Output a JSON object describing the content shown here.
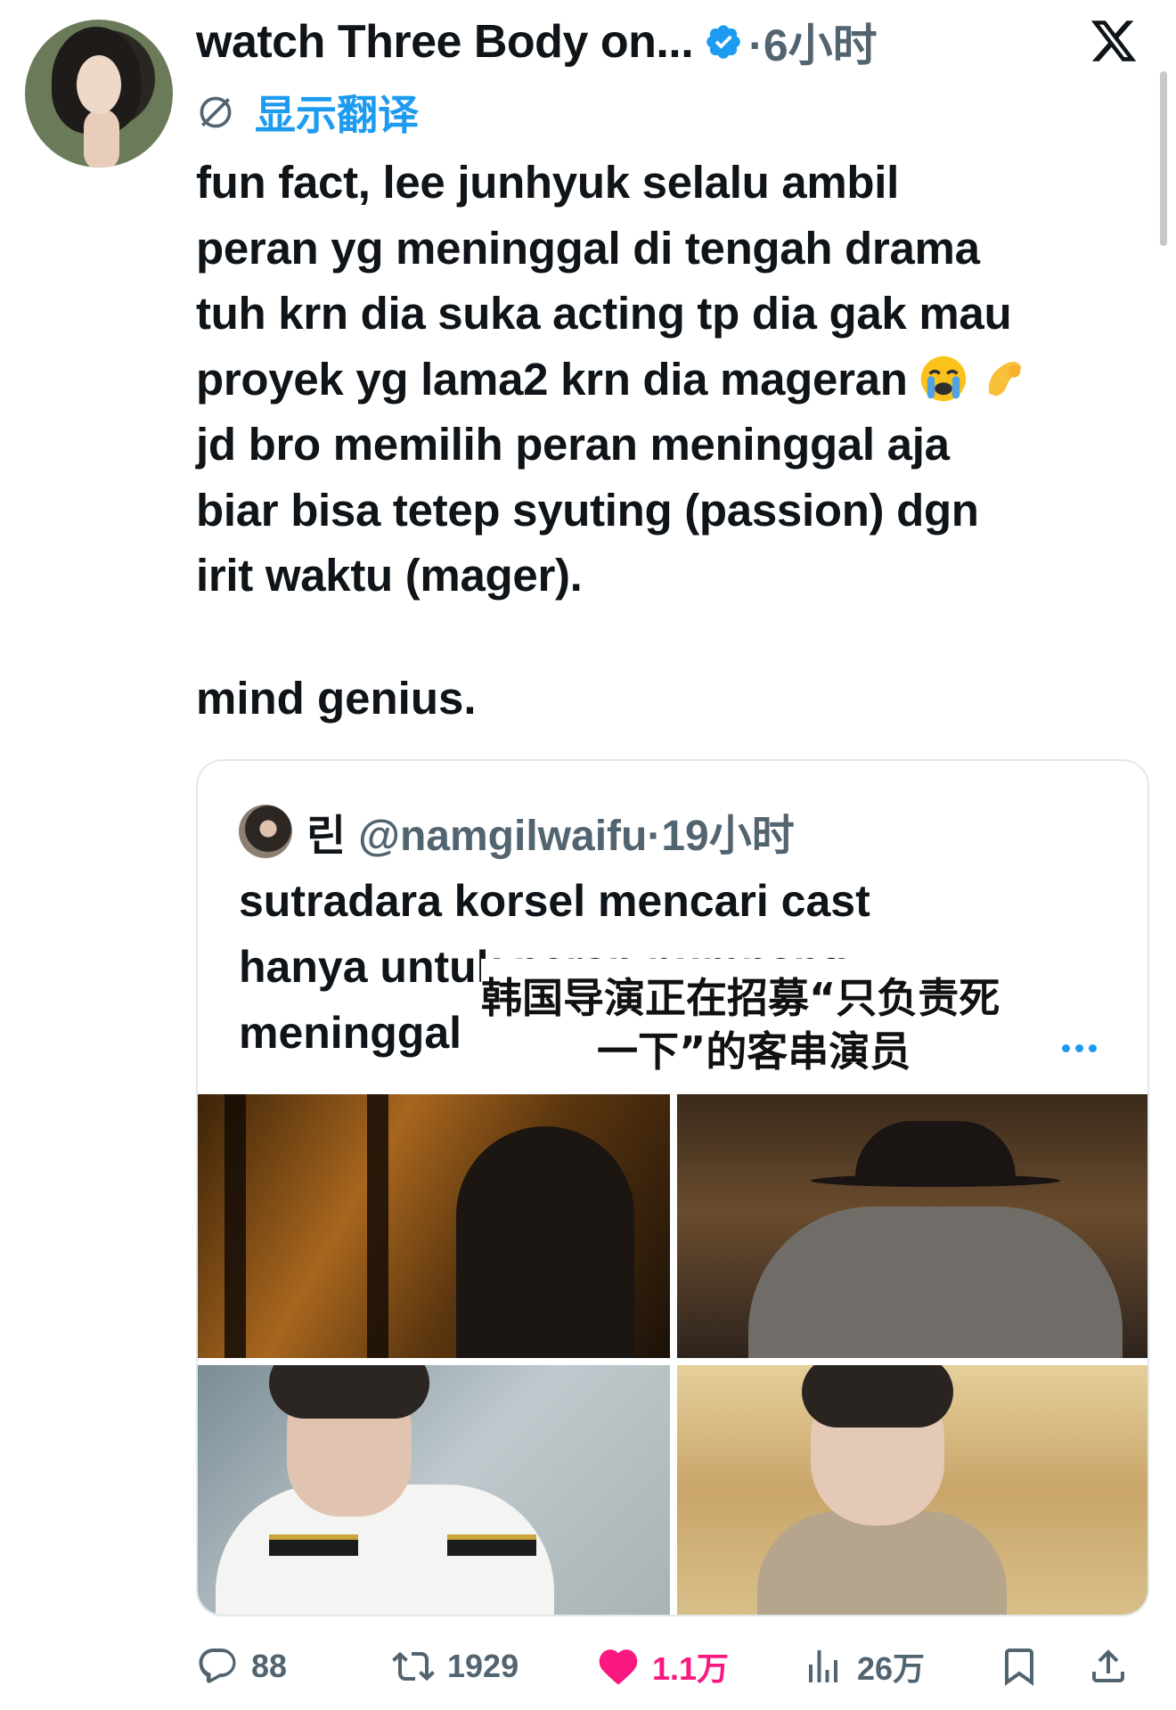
{
  "author": {
    "display_name": "watch Three Body on...",
    "time": "6小时"
  },
  "translate_label": "显示翻译",
  "tweet_lines": [
    "fun fact, lee junhyuk selalu ambil",
    "peran yg meninggal di tengah drama",
    "tuh krn dia suka acting tp dia gak mau",
    "proyek yg lama2 krn dia mageran",
    "jd bro memilih peran meninggal aja",
    "biar bisa tetep syuting (passion) dgn",
    "irit waktu (mager)."
  ],
  "tweet_closing": "mind genius.",
  "quote": {
    "name": "린",
    "handle": "@namgilwaifu",
    "time": "19小时",
    "lines": [
      "sutradara korsel mencari cast",
      "hanya untuk peran numpang",
      "meninggal"
    ],
    "subtitle_line1": "韩国导演正在招募“只负责死",
    "subtitle_line2": "一下”的客串演员"
  },
  "actions": {
    "replies": "88",
    "reposts": "1929",
    "likes": "1.1万",
    "views": "26万"
  },
  "colors": {
    "accent": "#1d9bf0",
    "like": "#f91880",
    "muted": "#536471"
  }
}
